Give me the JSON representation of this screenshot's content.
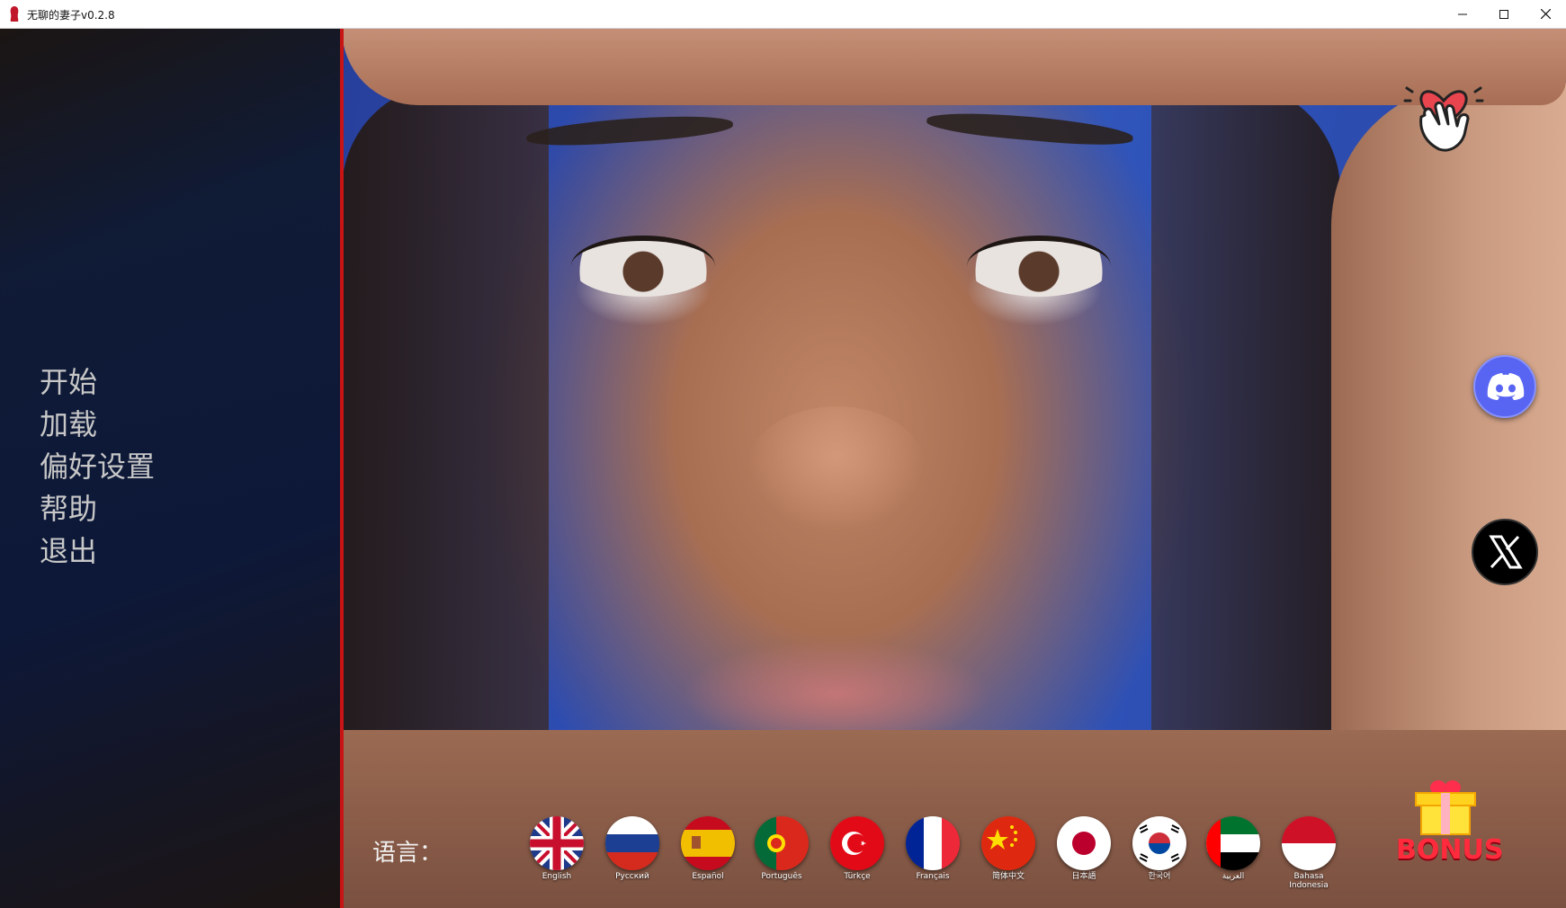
{
  "window": {
    "title": "无聊的妻子v0.2.8"
  },
  "menu": {
    "items": [
      {
        "label": "开始"
      },
      {
        "label": "加载"
      },
      {
        "label": "偏好设置"
      },
      {
        "label": "帮助"
      },
      {
        "label": "退出"
      }
    ]
  },
  "language": {
    "label": "语言：",
    "flags": [
      {
        "label": "English",
        "icon": "uk-flag-icon"
      },
      {
        "label": "Русский",
        "icon": "russia-flag-icon"
      },
      {
        "label": "Español",
        "icon": "spain-flag-icon"
      },
      {
        "label": "Português",
        "icon": "portugal-flag-icon"
      },
      {
        "label": "Türkçe",
        "icon": "turkey-flag-icon"
      },
      {
        "label": "Français",
        "icon": "france-flag-icon"
      },
      {
        "label": "简体中文",
        "icon": "china-flag-icon"
      },
      {
        "label": "日本語",
        "icon": "japan-flag-icon"
      },
      {
        "label": "한국어",
        "icon": "korea-flag-icon"
      },
      {
        "label": "العربية",
        "icon": "uae-flag-icon"
      },
      {
        "label": "Bahasa Indonesia",
        "icon": "indonesia-flag-icon"
      }
    ]
  },
  "social": {
    "support": "heart-hand-icon",
    "discord": "discord-icon",
    "x": "x-logo-icon"
  },
  "bonus": {
    "label": "BONUS",
    "icon": "gift-icon"
  },
  "colors": {
    "accent_red": "#c81414",
    "menu_text": "#c7c7c7",
    "discord_blue": "#5865f2"
  }
}
